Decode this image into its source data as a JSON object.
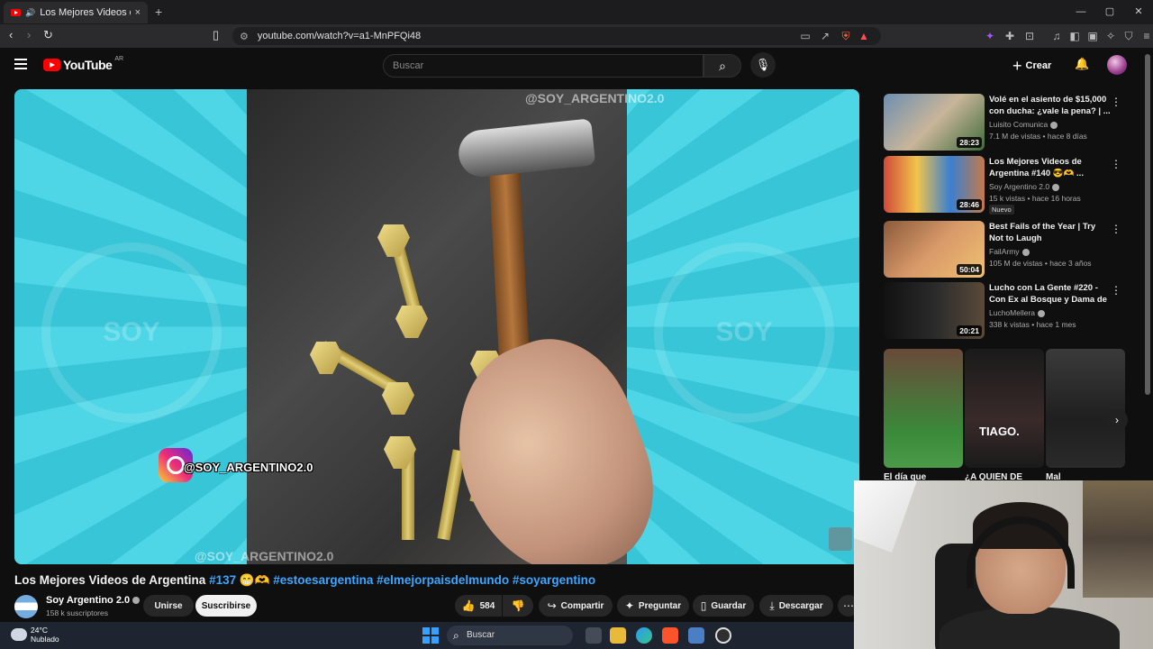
{
  "browser": {
    "tab_title": "Los Mejores Videos de Argen",
    "tab_close": "×",
    "new_tab": "+",
    "url": "youtube.com/watch?v=a1-MnPFQi48",
    "window_controls": [
      "—",
      "▢",
      "✕"
    ]
  },
  "youtube": {
    "logo_text": "YouTube",
    "logo_country": "AR",
    "search_placeholder": "Buscar",
    "create_label": "Crear"
  },
  "video": {
    "watermark_top": "@SOY_ARGENTINO2.0",
    "watermark_bottom": "@SOY_ARGENTINO2.0",
    "instagram_handle": "@SOY_ARGENTINO2.0",
    "side_watermark": "SOY",
    "title_main": "Los Mejores Videos de Argentina",
    "title_num": "#137",
    "title_emoji": "😁🫶",
    "title_tags": "#estoesargentina #elmejorpaisdelmundo #soyargentino"
  },
  "channel": {
    "name": "Soy Argentino 2.0",
    "subscribers": "158 k suscriptores",
    "join_label": "Unirse",
    "subscribe_label": "Suscribirse"
  },
  "actions": {
    "likes": "584",
    "share": "Compartir",
    "ask": "Preguntar",
    "save": "Guardar",
    "download": "Descargar"
  },
  "recommendations": [
    {
      "title": "Volé en el asiento de $15,000 con ducha: ¿vale la pena? | ...",
      "channel": "Luisito Comunica",
      "meta": "7.1 M de vistas • hace 8 días",
      "duration": "28:23",
      "badge": ""
    },
    {
      "title": "Los Mejores Videos de Argentina #140 😎🫶 ...",
      "channel": "Soy Argentino 2.0",
      "meta": "15 k vistas • hace 16 horas",
      "duration": "28:46",
      "badge": "Nuevo"
    },
    {
      "title": "Best Fails of the Year | Try Not to Laugh",
      "channel": "FailArmy",
      "meta": "105 M de vistas • hace 3 años",
      "duration": "50:04",
      "badge": ""
    },
    {
      "title": "Lucho con La Gente #220 - Con Ex al Bosque y Dama de ...",
      "channel": "LuchoMellera",
      "meta": "338 k vistas • hace 1 mes",
      "duration": "20:21",
      "badge": ""
    }
  ],
  "shorts": {
    "labels": [
      "El día que",
      "¿A QUIÉN DE",
      "Mal"
    ],
    "overlay_text": "TIAGO."
  },
  "taskbar": {
    "temp": "24°C",
    "weather": "Nublado",
    "search": "Buscar"
  },
  "colors": {
    "accent_link": "#3ea6ff",
    "youtube_red": "#ff0000",
    "video_bg": "#3ac9dc"
  }
}
